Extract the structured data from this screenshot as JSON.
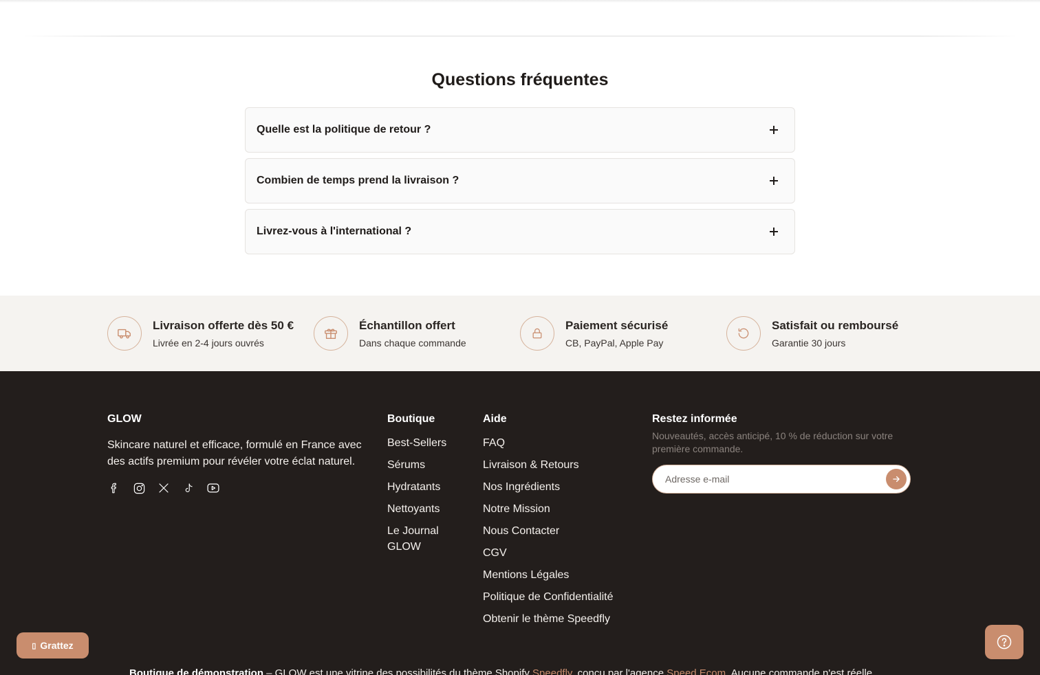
{
  "faq": {
    "title": "Questions fréquentes",
    "items": [
      {
        "question": "Quelle est la politique de retour ?"
      },
      {
        "question": "Combien de temps prend la livraison ?"
      },
      {
        "question": "Livrez-vous à l'international ?"
      }
    ]
  },
  "features": [
    {
      "icon": "truck-icon",
      "title": "Livraison offerte dès 50 €",
      "subtitle": "Livrée en 2-4 jours ouvrés"
    },
    {
      "icon": "gift-icon",
      "title": "Échantillon offert",
      "subtitle": "Dans chaque commande"
    },
    {
      "icon": "lock-icon",
      "title": "Paiement sécurisé",
      "subtitle": "CB, PayPal, Apple Pay"
    },
    {
      "icon": "refresh-icon",
      "title": "Satisfait ou remboursé",
      "subtitle": "Garantie 30 jours"
    }
  ],
  "footer": {
    "brand": "GLOW",
    "tagline": "Skincare naturel et efficace, formulé en France avec des actifs premium pour révéler votre éclat naturel.",
    "socials": [
      "facebook-icon",
      "instagram-icon",
      "x-icon",
      "tiktok-icon",
      "youtube-icon"
    ],
    "boutique": {
      "title": "Boutique",
      "links": [
        "Best-Sellers",
        "Sérums",
        "Hydratants",
        "Nettoyants",
        "Le Journal GLOW"
      ]
    },
    "aide": {
      "title": "Aide",
      "links": [
        "FAQ",
        "Livraison & Retours",
        "Nos Ingrédients",
        "Notre Mission",
        "Nous Contacter",
        "CGV",
        "Mentions Légales",
        "Politique de Confidentialité",
        "Obtenir le thème Speedfly"
      ]
    },
    "newsletter": {
      "title": "Restez informée",
      "text": "Nouveautés, accès anticipé, 10 % de réduction sur votre première commande.",
      "placeholder": "Adresse e-mail"
    }
  },
  "scratch_button": {
    "label": "Grattez"
  },
  "demo_notice": {
    "bold": "Boutique de démonstration",
    "text1": " – GLOW est une vitrine des possibilités du thème Shopify ",
    "link1": "Speedfly",
    "text2": ", conçu par l'agence ",
    "link2": "Speed Ecom",
    "text3": ". Aucune commande n'est réelle."
  },
  "colors": {
    "accent": "#c98d6e",
    "footer_bg": "#231e1c",
    "features_bg": "#f5f3f0"
  }
}
